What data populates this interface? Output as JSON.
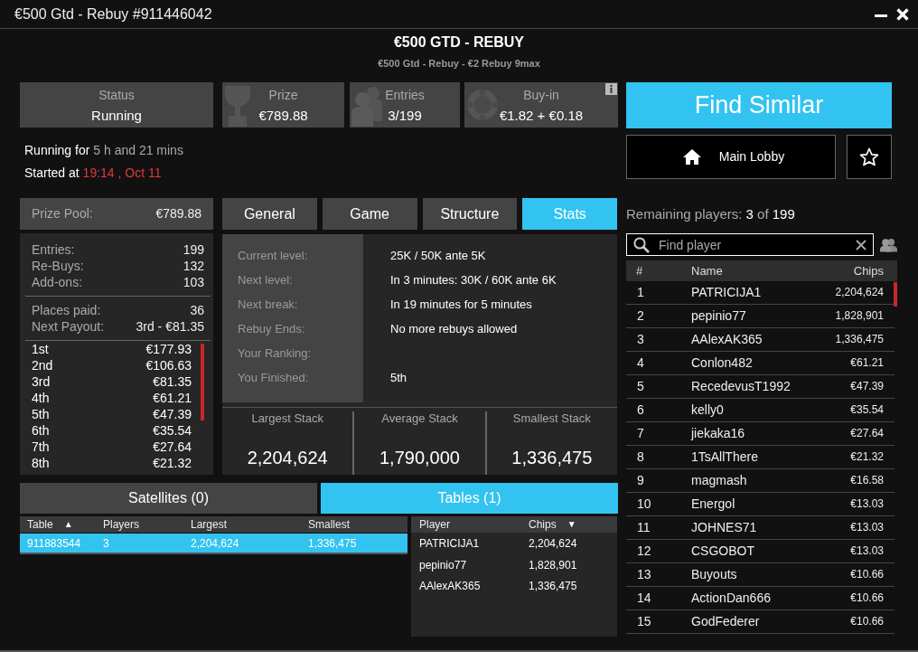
{
  "window": {
    "title": "€500 Gtd - Rebuy #911446042"
  },
  "header": {
    "title": "€500 GTD - REBUY",
    "subtitle": "€500 Gtd - Rebuy - €2 Rebuy 9max"
  },
  "info_tiles": [
    {
      "kind": "status",
      "label": "Status",
      "value": "Running"
    },
    {
      "kind": "prize",
      "label": "Prize",
      "value": "€789.88"
    },
    {
      "kind": "entries",
      "label": "Entries",
      "value": "3/199"
    },
    {
      "kind": "buyin",
      "label": "Buy-in",
      "value": "€1.82 + €0.18",
      "info": true
    }
  ],
  "timing": [
    {
      "kind": "duration",
      "label": "Running for",
      "value": "5 h and 21 mins"
    },
    {
      "kind": "start",
      "label": "Started at",
      "value": "19:14 , Oct 11"
    }
  ],
  "prize_pool": {
    "label": "Prize Pool:",
    "value": "€789.88"
  },
  "summary": [
    [
      {
        "label": "Entries:",
        "value": "199"
      },
      {
        "label": "Re-Buys:",
        "value": "132"
      },
      {
        "label": "Add-ons:",
        "value": "103"
      }
    ],
    [
      {
        "label": "Places paid:",
        "value": "36"
      },
      {
        "label": "Next Payout:",
        "value": "3rd - €81.35"
      }
    ]
  ],
  "payouts": [
    {
      "place": "1st",
      "amount": "€177.93"
    },
    {
      "place": "2nd",
      "amount": "€106.63"
    },
    {
      "place": "3rd",
      "amount": "€81.35"
    },
    {
      "place": "4th",
      "amount": "€61.21"
    },
    {
      "place": "5th",
      "amount": "€47.39"
    },
    {
      "place": "6th",
      "amount": "€35.54"
    },
    {
      "place": "7th",
      "amount": "€27.64"
    },
    {
      "place": "8th",
      "amount": "€21.32"
    }
  ],
  "detail_tabs": [
    {
      "label": "General",
      "selected": false
    },
    {
      "label": "Game",
      "selected": false
    },
    {
      "label": "Structure",
      "selected": false
    },
    {
      "label": "Stats",
      "selected": true
    }
  ],
  "stats": {
    "rows": [
      {
        "label": "Current level:",
        "value": "25K / 50K ante 5K"
      },
      {
        "label": "Next level:",
        "value": "In 3 minutes: 30K / 60K ante 6K"
      },
      {
        "label": "Next break:",
        "value": "In 19 minutes for 5 minutes"
      },
      {
        "label": "Rebuy Ends:",
        "value": "No more rebuys allowed"
      },
      {
        "label": "Your Ranking:"
      },
      {
        "label": "You Finished:",
        "value": "5th"
      }
    ],
    "stacks": [
      {
        "label": "Largest Stack",
        "value": "2,204,624"
      },
      {
        "label": "Average Stack",
        "value": "1,790,000"
      },
      {
        "label": "Smallest Stack",
        "value": "1,336,475"
      }
    ]
  },
  "bottom_tabs": [
    {
      "label": "Satellites (0)",
      "selected": false
    },
    {
      "label": "Tables (1)",
      "selected": true
    }
  ],
  "tables": {
    "columns": [
      {
        "label": "Table",
        "sort_mark": "▲"
      },
      {
        "label": "Players"
      },
      {
        "label": "Largest"
      },
      {
        "label": "Smallest"
      }
    ],
    "rows": [
      {
        "selected": true,
        "cells": [
          "911883544",
          "3",
          "2,204,624",
          "1,336,475"
        ]
      }
    ]
  },
  "table_players": {
    "columns": [
      {
        "label": "Player"
      },
      {
        "label": "Chips",
        "sort_mark": "▼"
      }
    ],
    "rows": [
      {
        "name": "PATRICIJA1",
        "chips": "2,204,624"
      },
      {
        "name": "pepinio77",
        "chips": "1,828,901"
      },
      {
        "name": "AAlexAK365",
        "chips": "1,336,475"
      }
    ]
  },
  "actions": {
    "find_similar": "Find Similar",
    "main_lobby": "Main Lobby"
  },
  "remaining": {
    "label": "Remaining players:",
    "count": "3",
    "separator": "of",
    "total": "199"
  },
  "search": {
    "placeholder": "Find player"
  },
  "players": {
    "columns": [
      {
        "label": "#"
      },
      {
        "label": "Name"
      },
      {
        "label": "Chips"
      }
    ],
    "rows": [
      {
        "rank": "1",
        "name": "PATRICIJA1",
        "chips": "2,204,624"
      },
      {
        "rank": "2",
        "name": "pepinio77",
        "chips": "1,828,901"
      },
      {
        "rank": "3",
        "name": "AAlexAK365",
        "chips": "1,336,475"
      },
      {
        "rank": "4",
        "name": "Conlon482",
        "chips": "€61.21"
      },
      {
        "rank": "5",
        "name": "RecedevusT1992",
        "chips": "€47.39"
      },
      {
        "rank": "6",
        "name": "kelly0",
        "chips": "€35.54"
      },
      {
        "rank": "7",
        "name": "jiekaka16",
        "chips": "€27.64"
      },
      {
        "rank": "8",
        "name": "1TsAllThere",
        "chips": "€21.32"
      },
      {
        "rank": "9",
        "name": "magmash",
        "chips": "€16.58"
      },
      {
        "rank": "10",
        "name": "Energol",
        "chips": "€13.03"
      },
      {
        "rank": "11",
        "name": "JOHNES71",
        "chips": "€13.03"
      },
      {
        "rank": "12",
        "name": "CSGOBOT",
        "chips": "€13.03"
      },
      {
        "rank": "13",
        "name": "Buyouts",
        "chips": "€10.66"
      },
      {
        "rank": "14",
        "name": "ActionDan666",
        "chips": "€10.66"
      },
      {
        "rank": "15",
        "name": "GodFederer",
        "chips": "€10.66"
      }
    ]
  }
}
